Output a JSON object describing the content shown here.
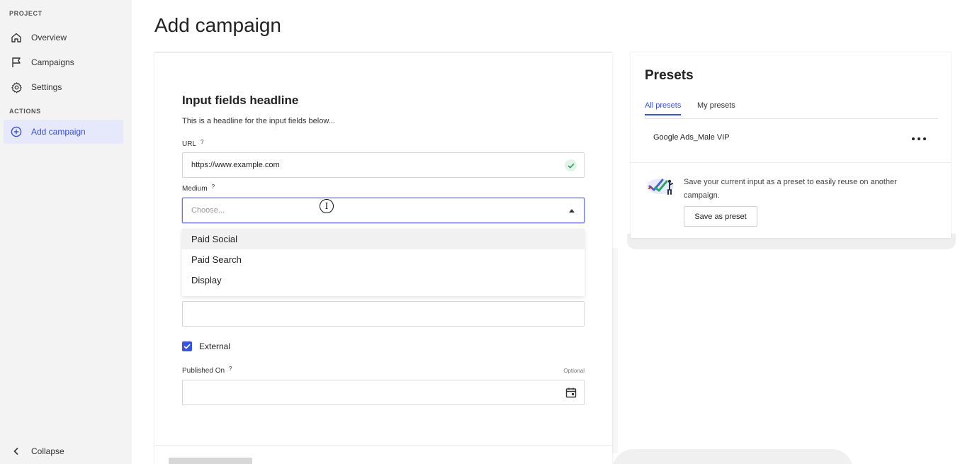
{
  "sidebar": {
    "project_label": "PROJECT",
    "actions_label": "ACTIONS",
    "items": [
      {
        "label": "Overview",
        "icon": "home-icon"
      },
      {
        "label": "Campaigns",
        "icon": "flag-icon"
      },
      {
        "label": "Settings",
        "icon": "gear-icon"
      },
      {
        "label": "Add campaign",
        "icon": "plus-circle-icon",
        "active": true
      }
    ],
    "collapse_label": "Collapse"
  },
  "page": {
    "title": "Add campaign"
  },
  "form": {
    "headline": "Input fields headline",
    "subheadline": "This is a headline for the input fields below...",
    "url": {
      "label": "URL",
      "help": "?",
      "value": "https://www.example.com",
      "valid": true
    },
    "medium": {
      "label": "Medium",
      "help": "?",
      "placeholder": "Choose...",
      "options": [
        "Paid Social",
        "Paid Search",
        "Display"
      ],
      "hovered_option": "Paid Social"
    },
    "external": {
      "label": "External",
      "checked": true
    },
    "published_on": {
      "label": "Published On",
      "help": "?",
      "optional": "Optional",
      "value": ""
    }
  },
  "presets": {
    "title": "Presets",
    "tabs": [
      "All presets",
      "My presets"
    ],
    "active_tab": "All presets",
    "items": [
      {
        "name": "Google Ads_Male VIP"
      }
    ],
    "save_text": "Save your current input as a preset to easily reuse on another campaign.",
    "save_button": "Save as preset"
  },
  "colors": {
    "accent": "#3a56d8",
    "sidebar_bg": "#f3f3f3",
    "active_item_bg": "#e6e9fb",
    "valid_green": "#2e9e5b"
  }
}
